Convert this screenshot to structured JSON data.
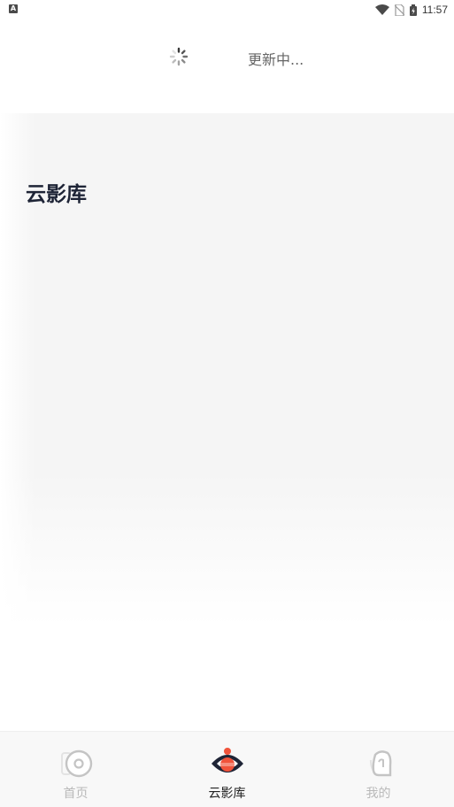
{
  "status_bar": {
    "left_icon_letter": "A",
    "time": "11:57"
  },
  "refresh": {
    "text": "更新中..."
  },
  "page": {
    "title": "云影库"
  },
  "bottom_nav": {
    "items": [
      {
        "label": "首页",
        "icon": "home-disc-icon",
        "active": false
      },
      {
        "label": "云影库",
        "icon": "eye-library-icon",
        "active": true
      },
      {
        "label": "我的",
        "icon": "profile-icon",
        "active": false
      }
    ]
  },
  "colors": {
    "accent": "#f0533b",
    "active_icon": "#1e2436",
    "inactive": "#b9b9b9"
  }
}
